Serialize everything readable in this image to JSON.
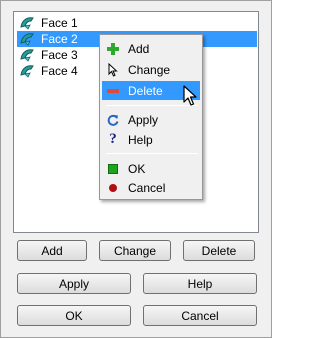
{
  "faces": [
    {
      "label": "Face 1",
      "selected": false
    },
    {
      "label": "Face 2",
      "selected": true
    },
    {
      "label": "Face 3",
      "selected": false
    },
    {
      "label": "Face 4",
      "selected": false
    }
  ],
  "context_menu": {
    "add": "Add",
    "change": "Change",
    "delete": "Delete",
    "apply": "Apply",
    "help": "Help",
    "ok": "OK",
    "cancel": "Cancel",
    "highlighted": "Delete"
  },
  "buttons": {
    "add": "Add",
    "change": "Change",
    "delete": "Delete",
    "apply": "Apply",
    "help": "Help",
    "ok": "OK",
    "cancel": "Cancel"
  },
  "icons": {
    "face": "face-icon",
    "add": "plus-icon",
    "change": "arrow-cursor-icon",
    "delete": "minus-icon",
    "apply": "refresh-icon",
    "help": "question-icon",
    "ok": "green-square-icon",
    "cancel": "red-dot-icon"
  },
  "colors": {
    "selection": "#3399ff",
    "add_icon": "#2ea82e",
    "delete_icon": "#e04a3a",
    "apply_icon": "#2a66c8",
    "ok_icon": "#1ea51e",
    "cancel_icon": "#b01010",
    "face_icon": "#2a9a9a"
  }
}
